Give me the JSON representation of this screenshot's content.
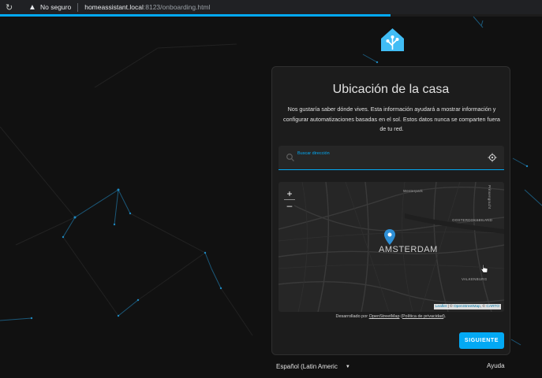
{
  "browser": {
    "not_secure": "No seguro",
    "url_host": "homeassistant.local",
    "url_rest": ":8123/onboarding.html",
    "load_progress": 0.72
  },
  "card": {
    "title": "Ubicación de la casa",
    "description": "Nos gustaría saber dónde vives. Esta información ayudará a mostrar información y configurar automatizaciones basadas en el sol. Estos datos nunca se comparten fuera de tu red.",
    "search_label": "Buscar dirección",
    "map": {
      "zoom_in": "+",
      "zoom_out": "–",
      "city": "AMSTERDAM",
      "labels": [
        "Westerpark",
        "OOSTERDOKSEILAND",
        "VALKENBURG",
        "Prinsengracht"
      ],
      "attribution_leaflet": "Leaflet",
      "attribution_osm": "OpenStreetMap",
      "attribution_carto": "CARTO"
    },
    "developed_prefix": "Desarrollado por",
    "developed_osm": "OpenStreetMap",
    "privacy_link": "Política de privacidad",
    "next_button": "SIGUIENTE"
  },
  "footer": {
    "language": "Español (Latin Americ",
    "help": "Ayuda"
  },
  "colors": {
    "accent": "#03a9f4",
    "background": "#111111",
    "card": "#1c1c1c"
  }
}
